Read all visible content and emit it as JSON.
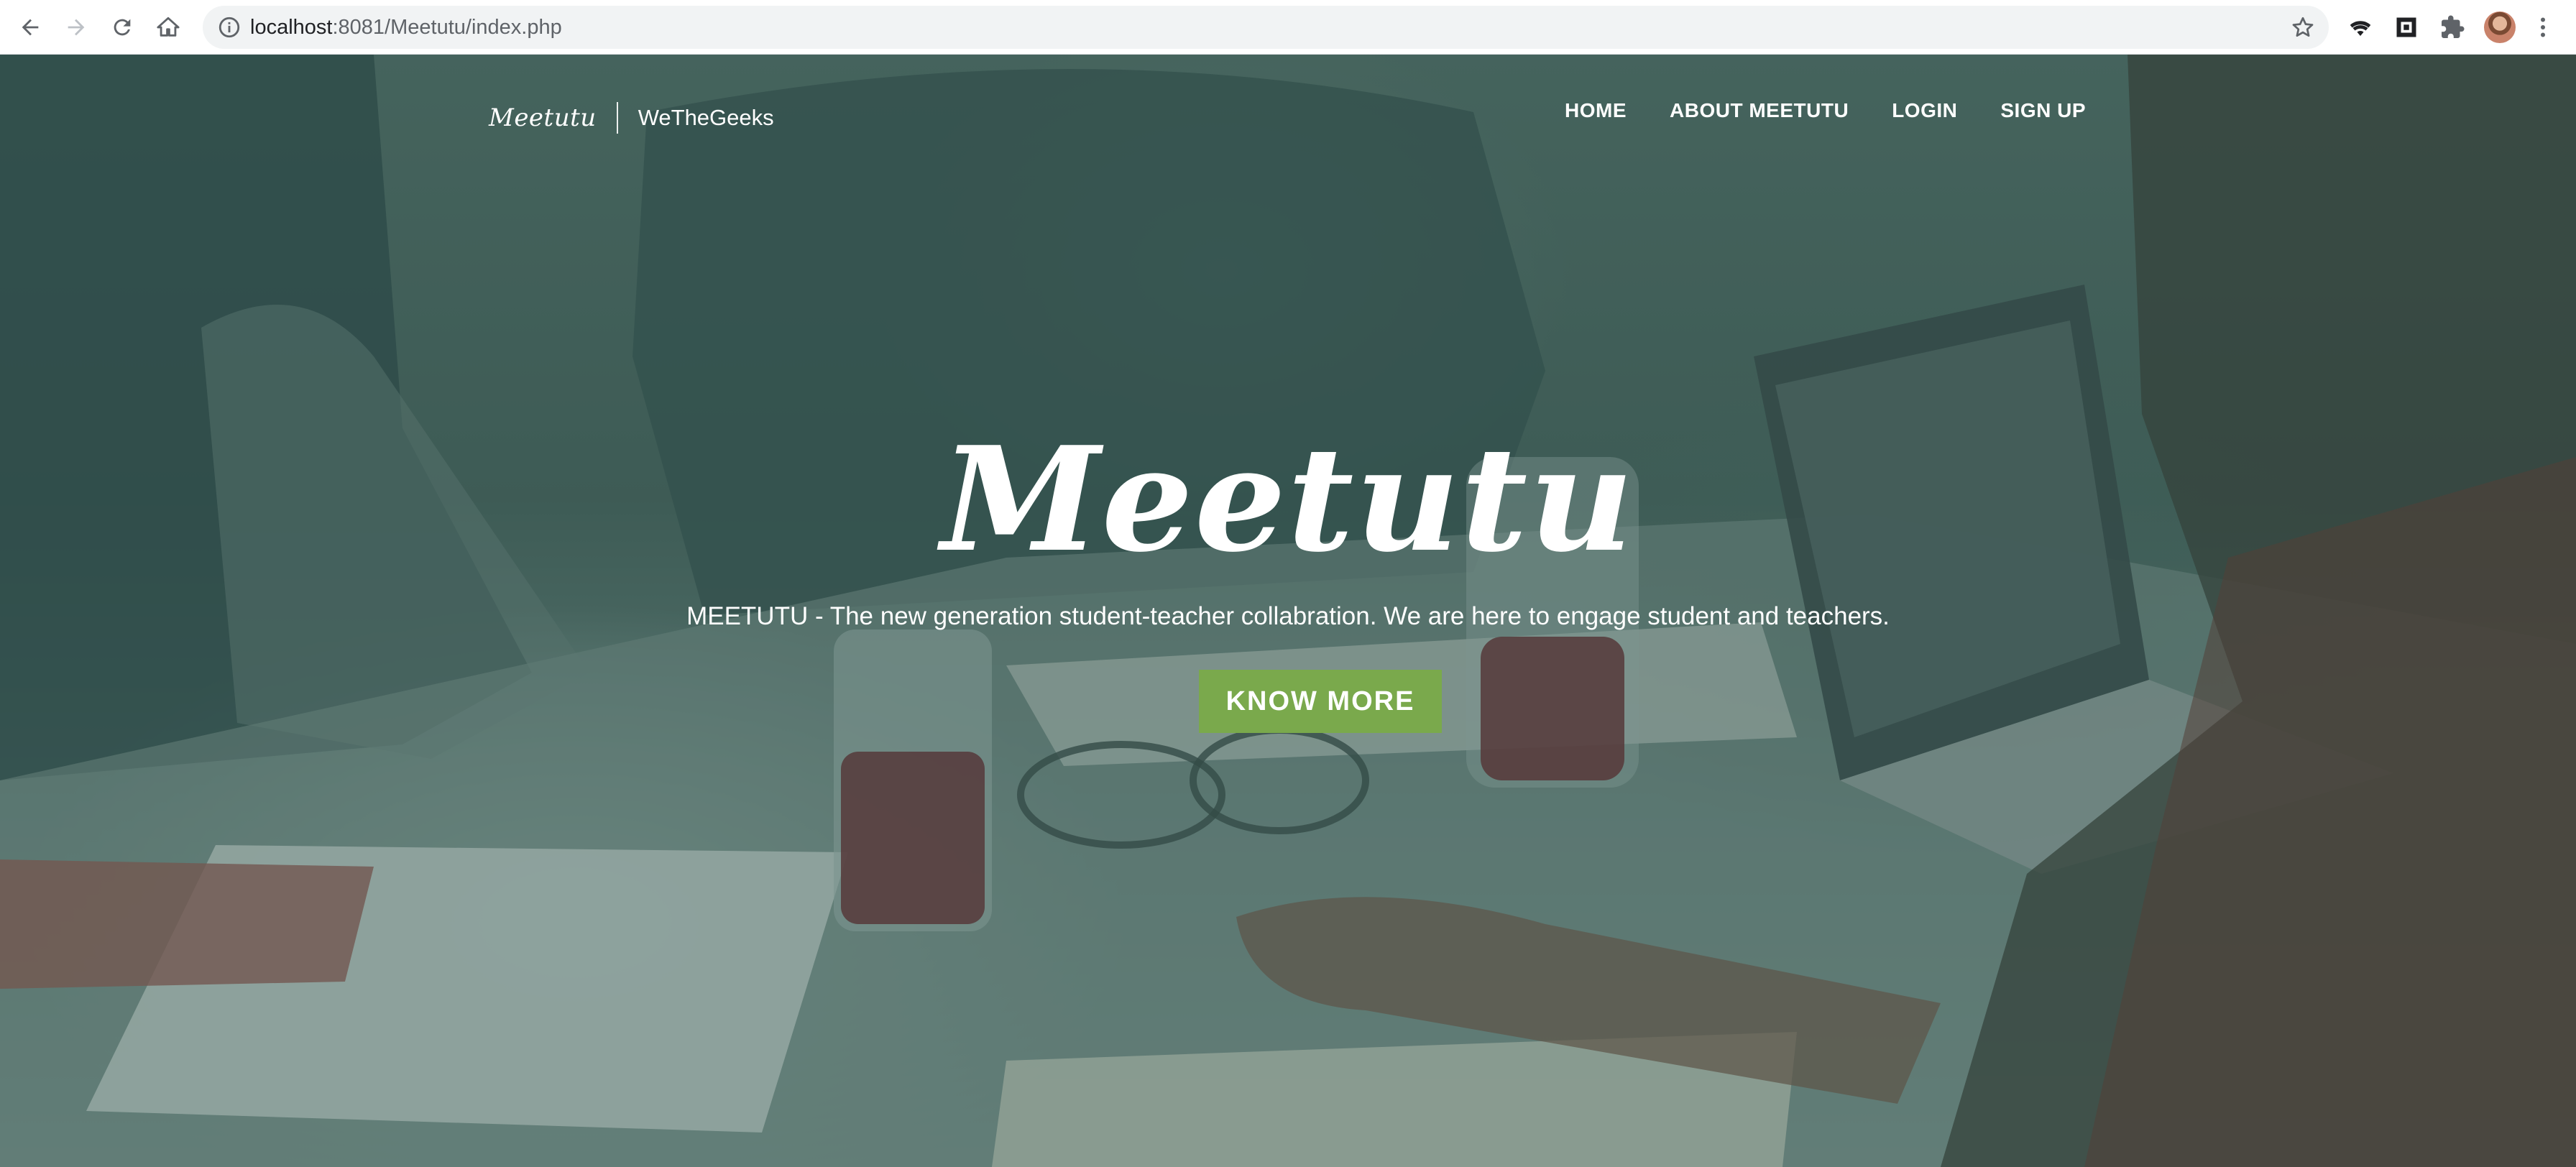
{
  "browser": {
    "url_host": "localhost",
    "url_path": ":8081/Meetutu/index.php",
    "icons": {
      "back": "arrow-left-icon",
      "forward": "arrow-right-icon",
      "reload": "reload-icon",
      "home": "home-icon",
      "site_info": "info-icon",
      "bookmark": "star-icon",
      "wifi": "wifi-icon",
      "extension_frame": "frame-icon",
      "extensions": "puzzle-icon",
      "menu": "kebab-menu-icon"
    }
  },
  "navbar": {
    "logo_text": "Meetutu",
    "brand_name": "WeTheGeeks",
    "links": [
      {
        "label": "HOME"
      },
      {
        "label": "ABOUT MEETUTU"
      },
      {
        "label": "LOGIN"
      },
      {
        "label": "SIGN UP"
      }
    ]
  },
  "hero": {
    "title": "Meetutu",
    "subtitle": "MEETUTU - The new generation student-teacher collabration. We are here to engage student and teachers.",
    "cta_label": "KNOW MORE"
  },
  "colors": {
    "overlay": "#284a46",
    "cta_background": "#7aa94c",
    "text": "#ffffff"
  }
}
